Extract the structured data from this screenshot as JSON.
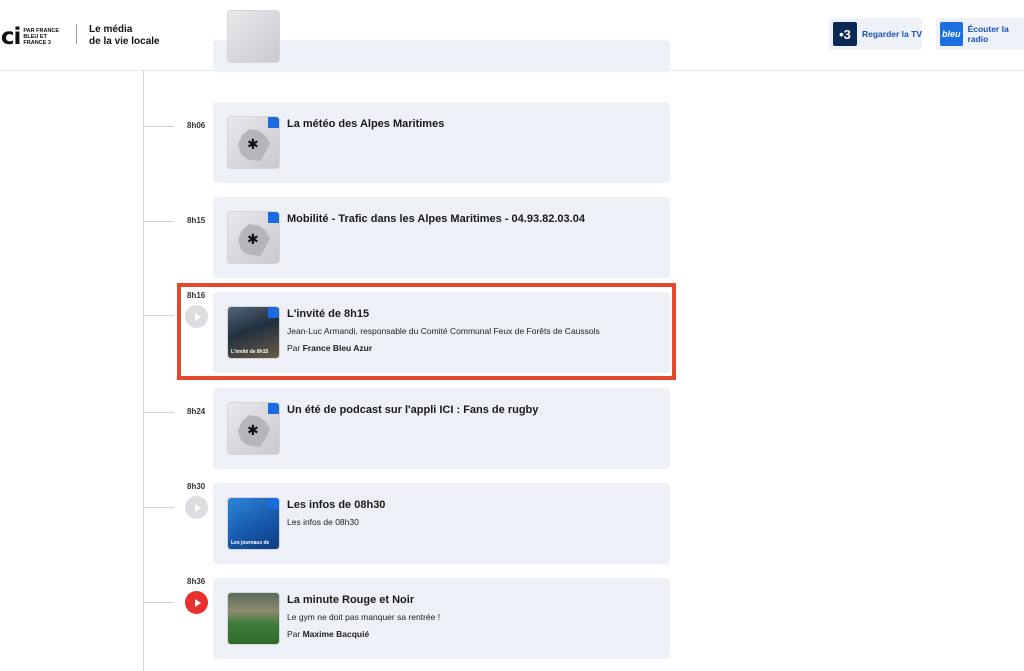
{
  "header": {
    "logo_main": "ici",
    "logo_par": "PAR FRANCE BLEU ET FRANCE 3",
    "tagline_line1": "Le média",
    "tagline_line2": "de la vie locale",
    "tv_icon_glyph": "•3",
    "tv_button_label": "Regarder la TV",
    "radio_icon_glyph": "bleu",
    "radio_button_label": "Écouter la radio"
  },
  "programs": [
    {
      "time": "8h06",
      "title": "La météo des Alpes Maritimes",
      "description": "",
      "by_prefix": "",
      "by_name": "",
      "thumb_icon": "france-map-icon"
    },
    {
      "time": "8h15",
      "title": "Mobilité - Trafic dans les Alpes Maritimes - 04.93.82.03.04",
      "description": "",
      "by_prefix": "",
      "by_name": "",
      "thumb_icon": "france-map-icon"
    },
    {
      "time": "8h16",
      "title": "L'invité de 8h15",
      "description": "Jean-Luc Armandi, responsable du Comité Communal Feux de Forêts de Caussols",
      "by_prefix": "Par",
      "by_name": "France Bleu Azur",
      "thumb_caption": "L'invité de 8h15",
      "highlighted": true
    },
    {
      "time": "8h24",
      "title": "Un été de podcast sur l'appli ICI : Fans de rugby",
      "description": "",
      "by_prefix": "",
      "by_name": "",
      "thumb_icon": "france-map-icon"
    },
    {
      "time": "8h30",
      "title": "Les infos de 08h30",
      "description": "Les infos de 08h30",
      "by_prefix": "",
      "by_name": "",
      "thumb_caption": "Les journaux de"
    },
    {
      "time": "8h36",
      "title": "La minute Rouge et Noir",
      "description": "Le gym ne doit pas manquer sa rentrée !",
      "by_prefix": "Par",
      "by_name": "Maxime Bacquié"
    }
  ],
  "colors": {
    "accent_red": "#e8302c",
    "highlight_border": "#e4482e",
    "card_bg": "#edf0f7",
    "link_blue": "#1652b5"
  }
}
